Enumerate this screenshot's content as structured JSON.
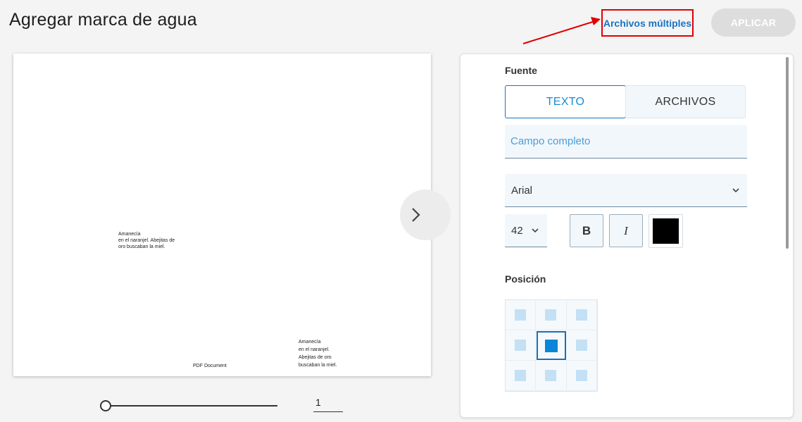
{
  "header": {
    "title": "Agregar marca de agua",
    "multiple_files_label": "Archivos múltiples",
    "apply_label": "APLICAR"
  },
  "preview": {
    "watermark_line1": "Amanecía",
    "watermark_line2": "en el naranjel. Abejitas de",
    "watermark_line3": "oro buscaban la miel.",
    "watermark_small_line1": "Amanecía",
    "watermark_small_line2": "en el naranjel.",
    "watermark_small_line3": "Abejitas de oro",
    "watermark_small_line4": "buscaban la miel.",
    "document_footer": "PDF Document",
    "page_number": "1",
    "next_icon": "chevron-right-icon"
  },
  "settings": {
    "source_label": "Fuente",
    "tabs": [
      {
        "label": "TEXTO",
        "active": true
      },
      {
        "label": "ARCHIVOS",
        "active": false
      }
    ],
    "text_placeholder": "Campo completo",
    "font_family": "Arial",
    "font_size": "42",
    "bold_label": "B",
    "italic_label": "I",
    "color": "#000000",
    "position_label": "Posición",
    "position_selected": "center"
  },
  "colors": {
    "accent": "#1a73c4",
    "annotation": "#e00000",
    "selected_cell": "#0a86d8"
  }
}
